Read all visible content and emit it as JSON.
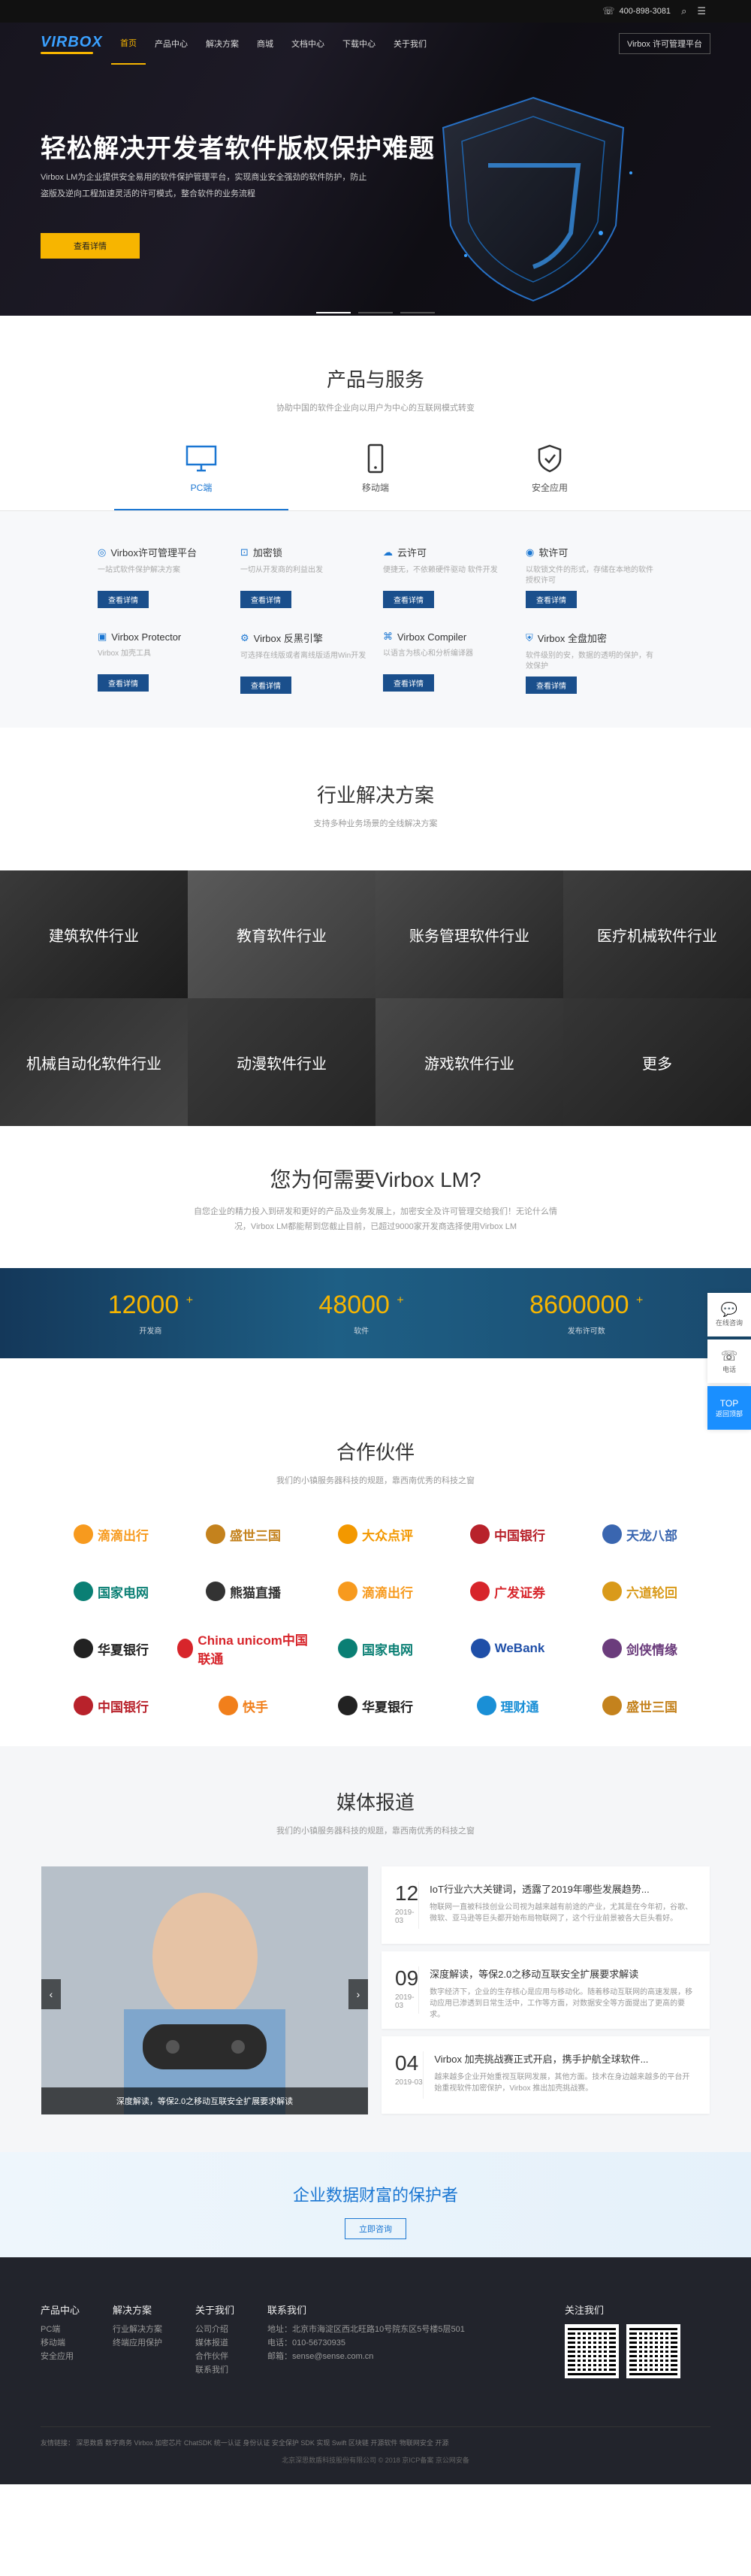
{
  "topbar": {
    "phone": "400-898-3081",
    "phone_icon": "phone-icon",
    "search_icon": "search-icon",
    "menu_icon": "menu-icon"
  },
  "nav": {
    "logo": "VIRBOX",
    "items": [
      "首页",
      "产品中心",
      "解决方案",
      "商城",
      "文档中心",
      "下载中心",
      "关于我们"
    ],
    "right": "Virbox 许可管理平台"
  },
  "hero": {
    "title": "轻松解决开发者软件版权保护难题",
    "desc": "Virbox LM为企业提供安全易用的软件保护管理平台，实现商业安全强劲的软件防护，防止盗版及逆向工程加速灵活的许可模式，整合软件的业务流程",
    "button": "查看详情"
  },
  "products": {
    "title": "产品与服务",
    "subtitle": "协助中国的软件企业向以用户为中心的互联网模式转变",
    "tabs": [
      {
        "label": "PC端",
        "icon": "monitor-icon"
      },
      {
        "label": "移动端",
        "icon": "mobile-icon"
      },
      {
        "label": "安全应用",
        "icon": "shield-icon"
      }
    ],
    "items": [
      {
        "name": "Virbox许可管理平台",
        "desc": "一站式软件保护解决方案",
        "button": "查看详情"
      },
      {
        "name": "加密锁",
        "desc": "一切从开发商的利益出发",
        "button": "查看详情"
      },
      {
        "name": "云许可",
        "desc": "便捷无，不依赖硬件驱动 软件开发",
        "button": "查看详情"
      },
      {
        "name": "软许可",
        "desc": "以软锁文件的形式，存储在本地的软件授权许可",
        "button": "查看详情"
      },
      {
        "name": "Virbox Protector",
        "desc": "Virbox 加壳工具",
        "button": "查看详情"
      },
      {
        "name": "Virbox 反黑引擎",
        "desc": "可选择在线版或者离线版适用Win开发",
        "button": "查看详情"
      },
      {
        "name": "Virbox Compiler",
        "desc": "以语言为核心和分析编译器",
        "button": "查看详情"
      },
      {
        "name": "Virbox 全盘加密",
        "desc": "软件级别的安，数据的透明的保护，有效保护",
        "button": "查看详情"
      }
    ]
  },
  "solutions": {
    "title": "行业解决方案",
    "subtitle": "支持多种业务场景的全线解决方案",
    "items": [
      "建筑软件行业",
      "教育软件行业",
      "账务管理软件行业",
      "医疗机械软件行业",
      "机械自动化软件行业",
      "动漫软件行业",
      "游戏软件行业",
      "更多"
    ]
  },
  "why": {
    "title": "您为何需要Virbox LM?",
    "desc": "自您企业的精力投入到研发和更好的产品及业务发展上，加密安全及许可管理交给我们！无论什么情况，Virbox LM都能帮到您截止目前，已超过9000家开发商选择使用Virbox LM",
    "stats": [
      {
        "value": "12000",
        "plus": "+",
        "label": "开发商"
      },
      {
        "value": "48000",
        "plus": "+",
        "label": "软件"
      },
      {
        "value": "8600000",
        "plus": "+",
        "label": "发布许可数"
      }
    ]
  },
  "side": [
    {
      "label": "在线咨询",
      "icon": "chat-icon"
    },
    {
      "label": "电话",
      "icon": "phone-icon"
    },
    {
      "label": "TOP",
      "sub": "返回顶部",
      "icon": "arrow-up-icon"
    }
  ],
  "partners": {
    "title": "合作伙伴",
    "subtitle": "我们的小镇服务器科技的规题，靠西南优秀的科技之窗",
    "logos": [
      {
        "name": "滴滴出行",
        "color": "#f79a1e"
      },
      {
        "name": "盛世三国",
        "color": "#c4821d"
      },
      {
        "name": "大众点评",
        "color": "#f39800"
      },
      {
        "name": "中国银行",
        "color": "#b8222b"
      },
      {
        "name": "天龙八部",
        "color": "#3a66b0"
      },
      {
        "name": "国家电网",
        "color": "#0a7f74"
      },
      {
        "name": "熊猫直播",
        "color": "#333333"
      },
      {
        "name": "滴滴出行",
        "color": "#f79a1e"
      },
      {
        "name": "广发证券",
        "color": "#d7252b"
      },
      {
        "name": "六道轮回",
        "color": "#d99a1a"
      },
      {
        "name": "华夏银行",
        "color": "#222222"
      },
      {
        "name": "China unicom中国联通",
        "color": "#d7252b"
      },
      {
        "name": "国家电网",
        "color": "#0a7f74"
      },
      {
        "name": "WeBank",
        "color": "#1f4fa8"
      },
      {
        "name": "剑侠情缘",
        "color": "#6b3c7c"
      },
      {
        "name": "中国银行",
        "color": "#b8222b"
      },
      {
        "name": "快手",
        "color": "#f17f1b"
      },
      {
        "name": "华夏银行",
        "color": "#222222"
      },
      {
        "name": "理财通",
        "color": "#1a8fd6"
      },
      {
        "name": "盛世三国",
        "color": "#c4821d"
      }
    ]
  },
  "media": {
    "title": "媒体报道",
    "subtitle": "我们的小镇服务器科技的规题，靠西南优秀的科技之窗",
    "caption": "深度解读，等保2.0之移动互联安全扩展要求解读",
    "news": [
      {
        "day": "12",
        "ym": "2019-03",
        "title": "IoT行业六大关键词，透露了2019年哪些发展趋势...",
        "text": "物联网一直被科技创业公司视为越来越有前途的产业，尤其是在今年初，谷歌、微软、亚马逊等巨头都开始布局物联网了，这个行业前景被各大巨头看好。"
      },
      {
        "day": "09",
        "ym": "2019-03",
        "title": "深度解读，等保2.0之移动互联安全扩展要求解读",
        "text": "数字经济下，企业的生存核心是应用与移动化。随着移动互联网的高速发展，移动应用已渗透到日常生活中，工作等方面，对数据安全等方面提出了更高的要求。"
      },
      {
        "day": "04",
        "ym": "2019-03",
        "title": "Virbox 加壳挑战赛正式开启，携手护航全球软件...",
        "text": "越来越多企业开始重视互联网发展，其他方面。技术在身边越来越多的平台开始重视软件加密保护，Virbox 推出加壳挑战赛。"
      }
    ]
  },
  "cta": {
    "title": "企业数据财富的保护者",
    "button": "立即咨询"
  },
  "footer": {
    "cols": [
      {
        "title": "产品中心",
        "links": [
          "PC端",
          "移动端",
          "安全应用"
        ]
      },
      {
        "title": "解决方案",
        "links": [
          "行业解决方案",
          "终端应用保护"
        ]
      },
      {
        "title": "关于我们",
        "links": [
          "公司介绍",
          "媒体报道",
          "合作伙伴",
          "联系我们"
        ]
      }
    ],
    "contact_title": "联系我们",
    "contact": [
      "地址：北京市海淀区西北旺路10号院东区5号楼5层501",
      "电话：010-56730935",
      "邮箱：sense@sense.com.cn"
    ],
    "qr_title": "关注我们",
    "links": "友情链接：   深思数盾   数字商务   Virbox   加密芯片   ChatSDK   统一认证   身份认证   安全保护   SDK   实现   Swift   区块链   开源软件   物联网安全   开源",
    "copyright": "北京深思数盾科技股份有限公司 © 2018   京ICP备案   京公网安备"
  }
}
